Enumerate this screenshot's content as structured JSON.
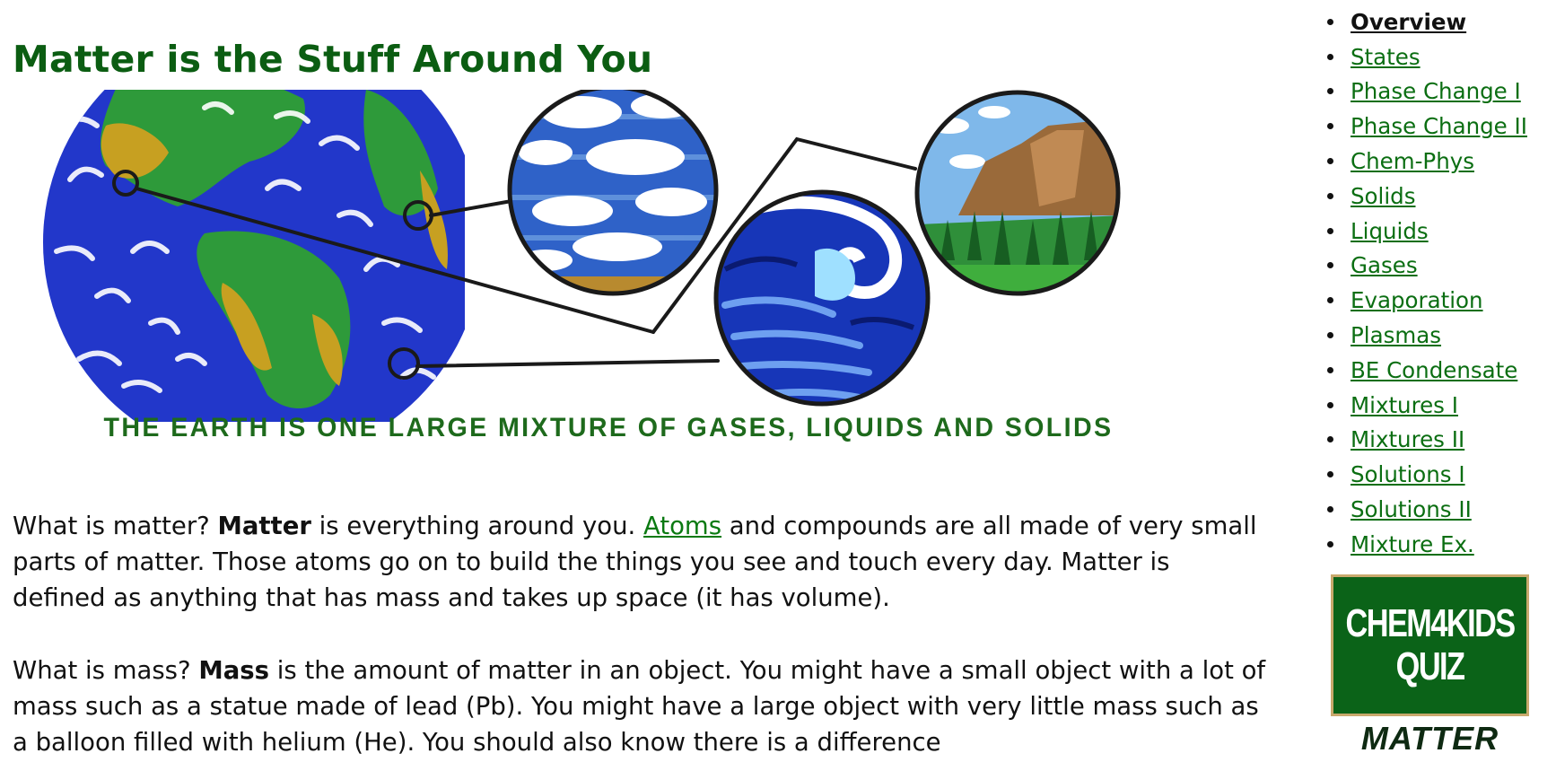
{
  "title": "Matter is the Stuff Around You",
  "hero": {
    "caption": "THE EARTH IS ONE LARGE MIXTURE OF GASES, LIQUIDS AND SOLIDS"
  },
  "paragraphs": {
    "p1": {
      "lead": "What is matter? ",
      "term": "Matter",
      "mid": " is everything around you. ",
      "link": "Atoms",
      "rest": " and compounds are all made of very small parts of matter. Those atoms go on to build the things you see and touch every day. Matter is defined as anything that has mass and takes up space (it has volume)."
    },
    "p2": {
      "lead": "What is mass? ",
      "term": "Mass",
      "rest": " is the amount of matter in an object. You might have a small object with a lot of mass such as a statue made of lead (Pb). You might have a large object with very little mass such as a balloon filled with helium (He). You should also know there is a difference"
    }
  },
  "sidebar": {
    "nav": [
      {
        "label": "Overview",
        "active": true
      },
      {
        "label": "States"
      },
      {
        "label": "Phase Change I"
      },
      {
        "label": "Phase Change II"
      },
      {
        "label": "Chem-Phys"
      },
      {
        "label": "Solids"
      },
      {
        "label": "Liquids"
      },
      {
        "label": "Gases"
      },
      {
        "label": "Evaporation"
      },
      {
        "label": "Plasmas"
      },
      {
        "label": "BE Condensate"
      },
      {
        "label": "Mixtures I"
      },
      {
        "label": "Mixtures II"
      },
      {
        "label": "Solutions I"
      },
      {
        "label": "Solutions II"
      },
      {
        "label": "Mixture Ex."
      }
    ],
    "quiz": {
      "line1": "CHEM4KIDS",
      "line2": "QUIZ",
      "subtitle": "MATTER"
    }
  },
  "colors": {
    "title": "#0b5d12",
    "link": "#0b6e12",
    "quiz_bg": "#0b6318",
    "quiz_border": "#c9a96d"
  }
}
